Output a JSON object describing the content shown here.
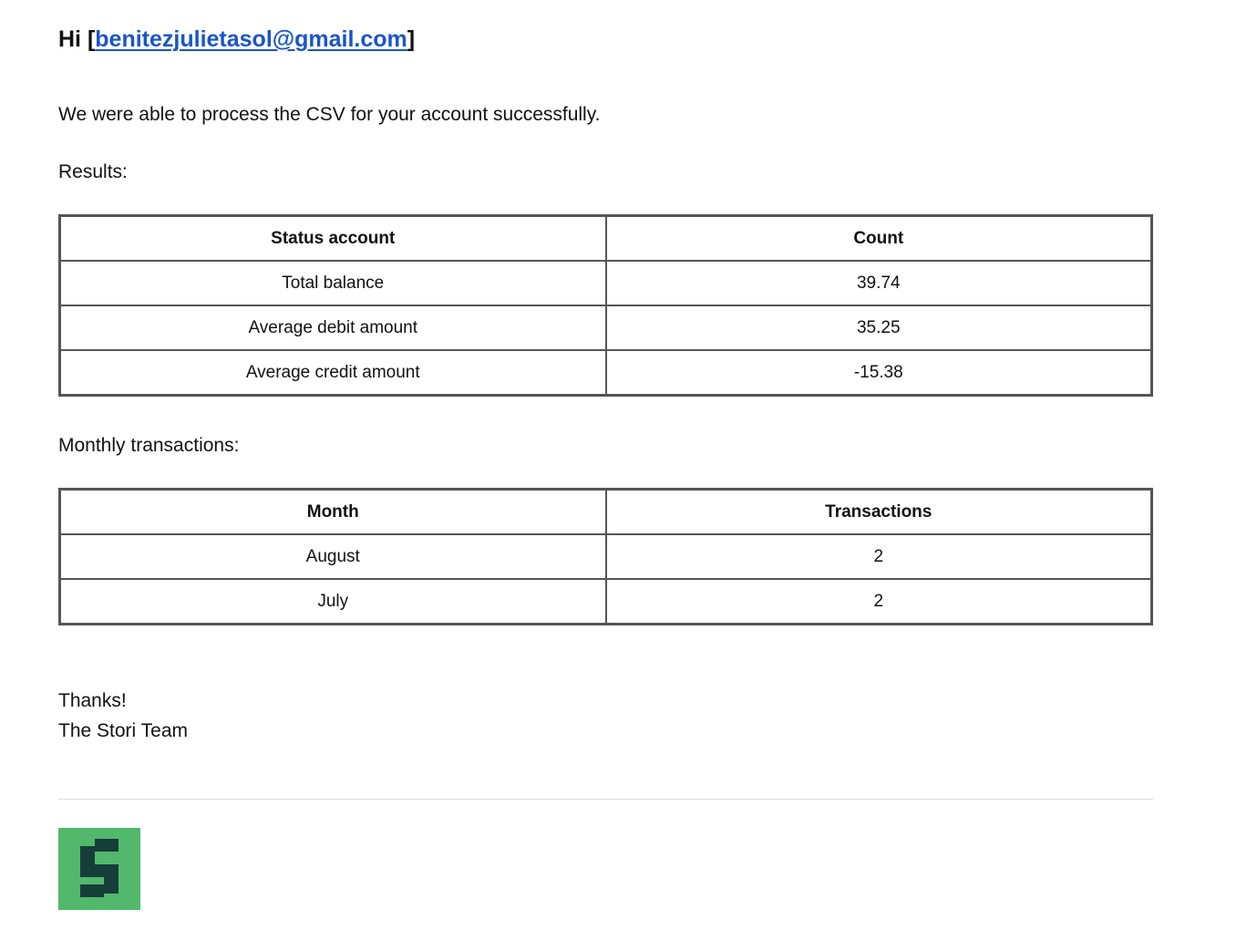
{
  "greeting": {
    "prefix": "Hi [",
    "email": "benitezjulietasol@gmail.com",
    "suffix": "]"
  },
  "intro_text": "We were able to process the CSV for your account successfully.",
  "results": {
    "label": "Results:",
    "headers": [
      "Status account",
      "Count"
    ],
    "rows": [
      [
        "Total balance",
        "39.74"
      ],
      [
        "Average debit amount",
        "35.25"
      ],
      [
        "Average credit amount",
        "-15.38"
      ]
    ]
  },
  "monthly": {
    "label": "Monthly transactions:",
    "headers": [
      "Month",
      "Transactions"
    ],
    "rows": [
      [
        "August",
        "2"
      ],
      [
        "July",
        "2"
      ]
    ]
  },
  "signoff": {
    "thanks": "Thanks!",
    "team": "The Stori Team"
  },
  "logo": {
    "icon": "stori-logo-icon",
    "background_color": "#52b86c",
    "mark_color": "#173d3a"
  },
  "colors": {
    "link": "#1a55c9",
    "table_border": "#555555",
    "divider": "#dcdcef"
  }
}
